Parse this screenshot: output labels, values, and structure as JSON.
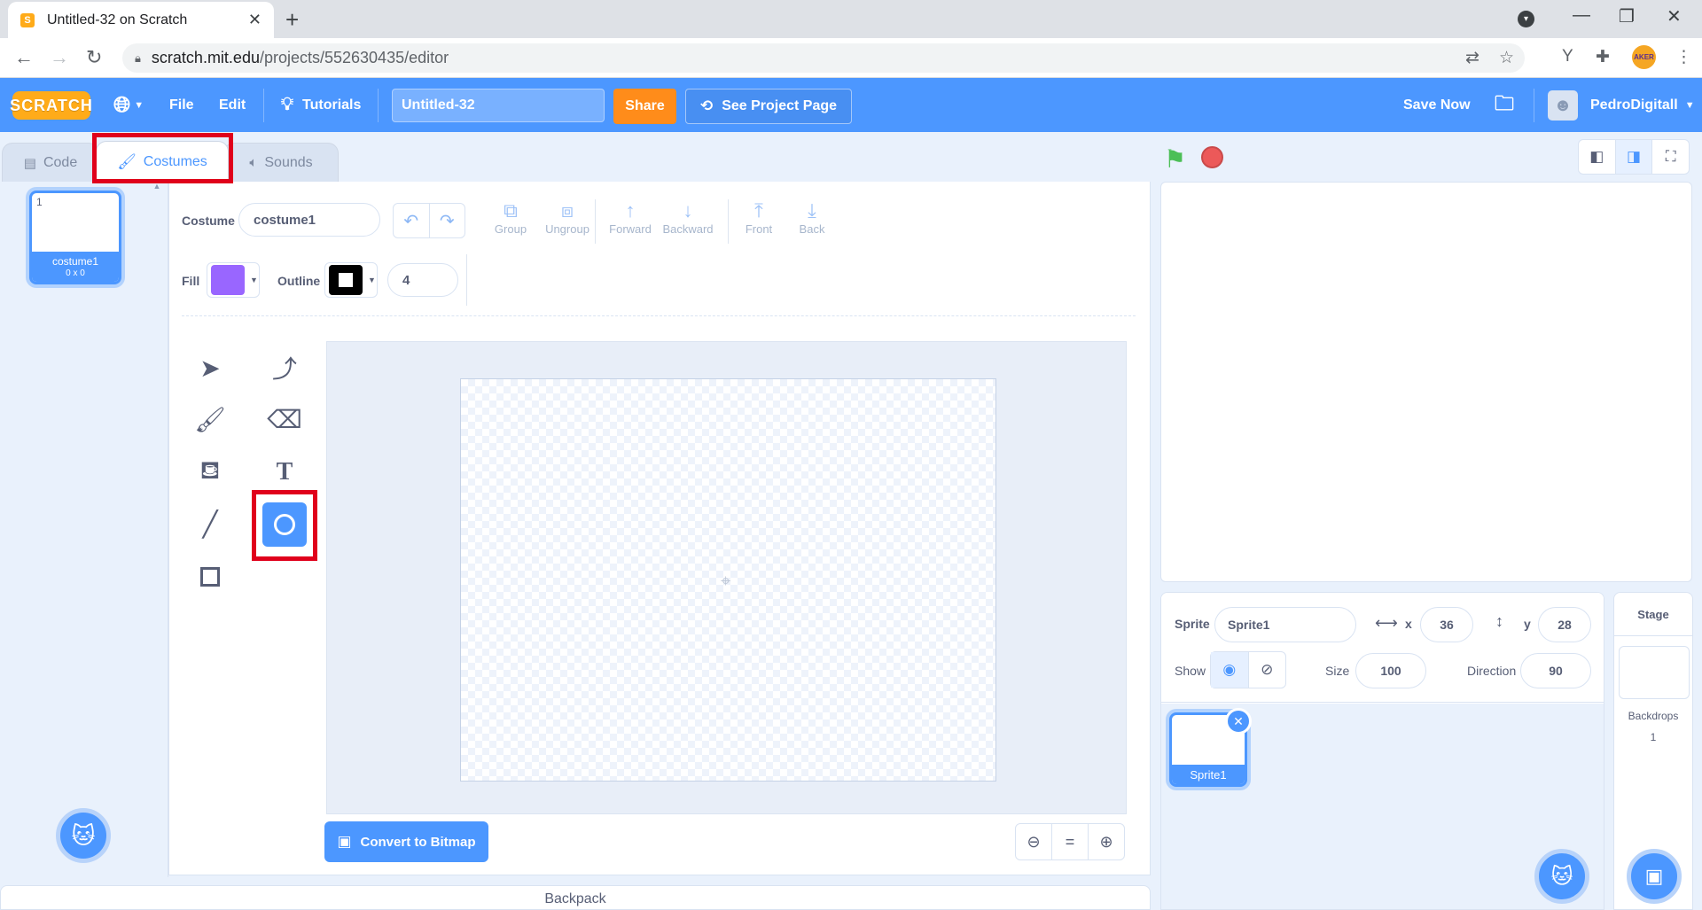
{
  "browser": {
    "tab_title": "Untitled-32 on Scratch",
    "tab_favicon": "S",
    "url_host": "scratch.mit.edu",
    "url_path": "/projects/552630435/editor",
    "ext_badge": "AKER"
  },
  "menubar": {
    "logo": "SCRATCH",
    "file": "File",
    "edit": "Edit",
    "tutorials": "Tutorials",
    "project_title": "Untitled-32",
    "share": "Share",
    "see_project_page": "See Project Page",
    "save_now": "Save Now",
    "username": "PedroDigitall"
  },
  "tabs": {
    "code": "Code",
    "costumes": "Costumes",
    "sounds": "Sounds",
    "active": "costumes"
  },
  "costume_list": {
    "items": [
      {
        "number": "1",
        "name": "costume1",
        "dimensions": "0 x 0"
      }
    ]
  },
  "paint": {
    "costume_label": "Costume",
    "costume_name": "costume1",
    "group": "Group",
    "ungroup": "Ungroup",
    "forward": "Forward",
    "backward": "Backward",
    "front": "Front",
    "back": "Back",
    "fill_label": "Fill",
    "fill_color": "#9966ff",
    "outline_label": "Outline",
    "outline_color": "#000000",
    "outline_width": "4",
    "convert": "Convert to Bitmap",
    "active_tool": "circle",
    "zoom_reset": "="
  },
  "backpack": "Backpack",
  "sprite_info": {
    "sprite_label": "Sprite",
    "sprite_name": "Sprite1",
    "x_label": "x",
    "x": "36",
    "y_label": "y",
    "y": "28",
    "show_label": "Show",
    "size_label": "Size",
    "size": "100",
    "direction_label": "Direction",
    "direction": "90",
    "sprites": [
      {
        "name": "Sprite1"
      }
    ]
  },
  "stage_pane": {
    "title": "Stage",
    "backdrops_label": "Backdrops",
    "backdrops_count": "1"
  },
  "colors": {
    "scratch_blue": "#4c97ff",
    "share_orange": "#ff8c1a",
    "annotation_red": "#e0001b"
  }
}
